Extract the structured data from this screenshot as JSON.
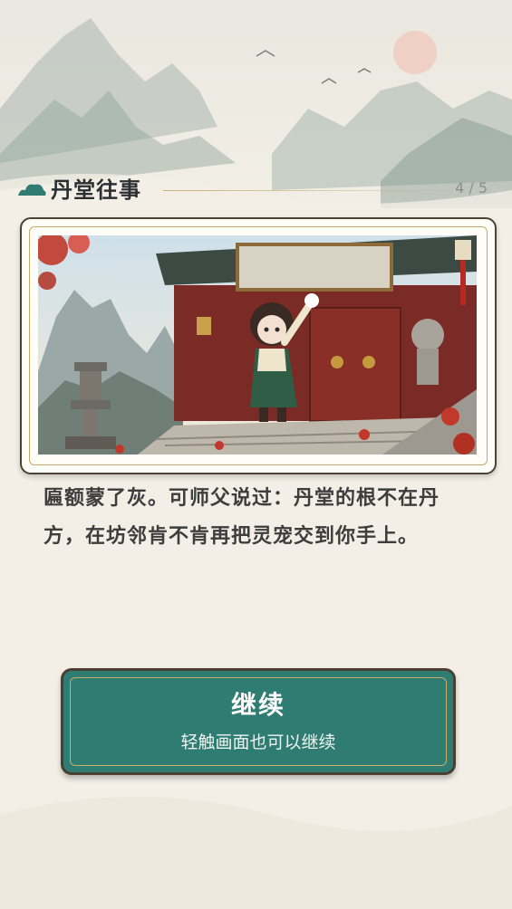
{
  "header": {
    "chapter_title": "丹堂往事",
    "page_counter": "4 / 5",
    "icon": "cloud-icon"
  },
  "scene": {
    "icon": "scene-illustration"
  },
  "story": {
    "text": "匾额蒙了灰。可师父说过：丹堂的根不在丹方，在坊邻肯不肯再把灵宠交到你手上。"
  },
  "continue": {
    "label": "继续",
    "hint": "轻触画面也可以继续"
  },
  "colors": {
    "background": "#f3efe6",
    "button": "#2f7c73",
    "accent_gold": "#c9ad6a",
    "text": "#3d3d3d"
  }
}
